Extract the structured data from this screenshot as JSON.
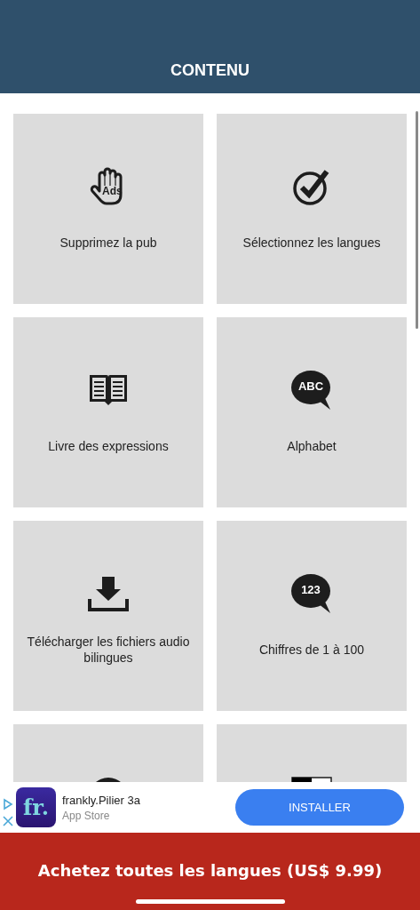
{
  "header": {
    "title": "CONTENU"
  },
  "tiles": [
    {
      "kind": "hand",
      "icon_text": "Ads",
      "label": "Supprimez la pub"
    },
    {
      "kind": "check",
      "label": "Sélectionnez les langues"
    },
    {
      "kind": "book",
      "label": "Livre des expressions"
    },
    {
      "kind": "bubble",
      "icon_text": "ABC",
      "label": "Alphabet"
    },
    {
      "kind": "download",
      "label": "Télécharger les fichiers audio bilingues"
    },
    {
      "kind": "bubble",
      "icon_text": "123",
      "label": "Chiffres de 1 à 100"
    },
    {
      "kind": "circle"
    },
    {
      "kind": "flag"
    }
  ],
  "ad": {
    "logo": "fr.",
    "title": "frankly.Pilier 3a",
    "source": "App Store",
    "button": "INSTALLER"
  },
  "purchase": {
    "label": "Achetez toutes les langues (US$ 9.99)"
  }
}
